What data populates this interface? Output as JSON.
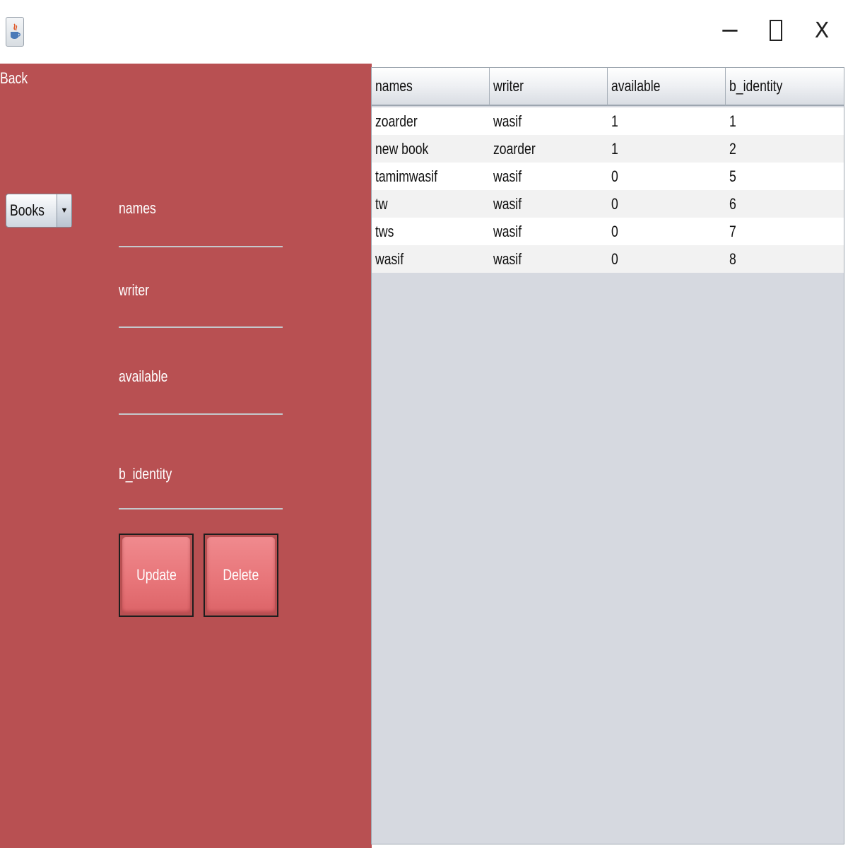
{
  "window": {
    "minimize_glyph": "−",
    "close_glyph": "X",
    "app_icon": "java-cup-icon"
  },
  "left_panel": {
    "background": "#b85052",
    "back_label": "Back",
    "category_select": {
      "selected": "Books",
      "arrow_glyph": "▼"
    },
    "fields": [
      {
        "label": "names",
        "value": ""
      },
      {
        "label": "writer",
        "value": ""
      },
      {
        "label": "available",
        "value": ""
      },
      {
        "label": "b_identity",
        "value": ""
      }
    ],
    "buttons": {
      "update": "Update",
      "delete": "Delete"
    }
  },
  "table": {
    "columns": [
      "names",
      "writer",
      "available",
      "b_identity"
    ],
    "rows": [
      [
        "zoarder",
        "wasif",
        "1",
        "1"
      ],
      [
        "new book",
        "zoarder",
        "1",
        "2"
      ],
      [
        "tamimwasif",
        "wasif",
        "0",
        "5"
      ],
      [
        "tw",
        "wasif",
        "0",
        "6"
      ],
      [
        "tws",
        "wasif",
        "0",
        "7"
      ],
      [
        "wasif",
        "wasif",
        "0",
        "8"
      ]
    ]
  }
}
